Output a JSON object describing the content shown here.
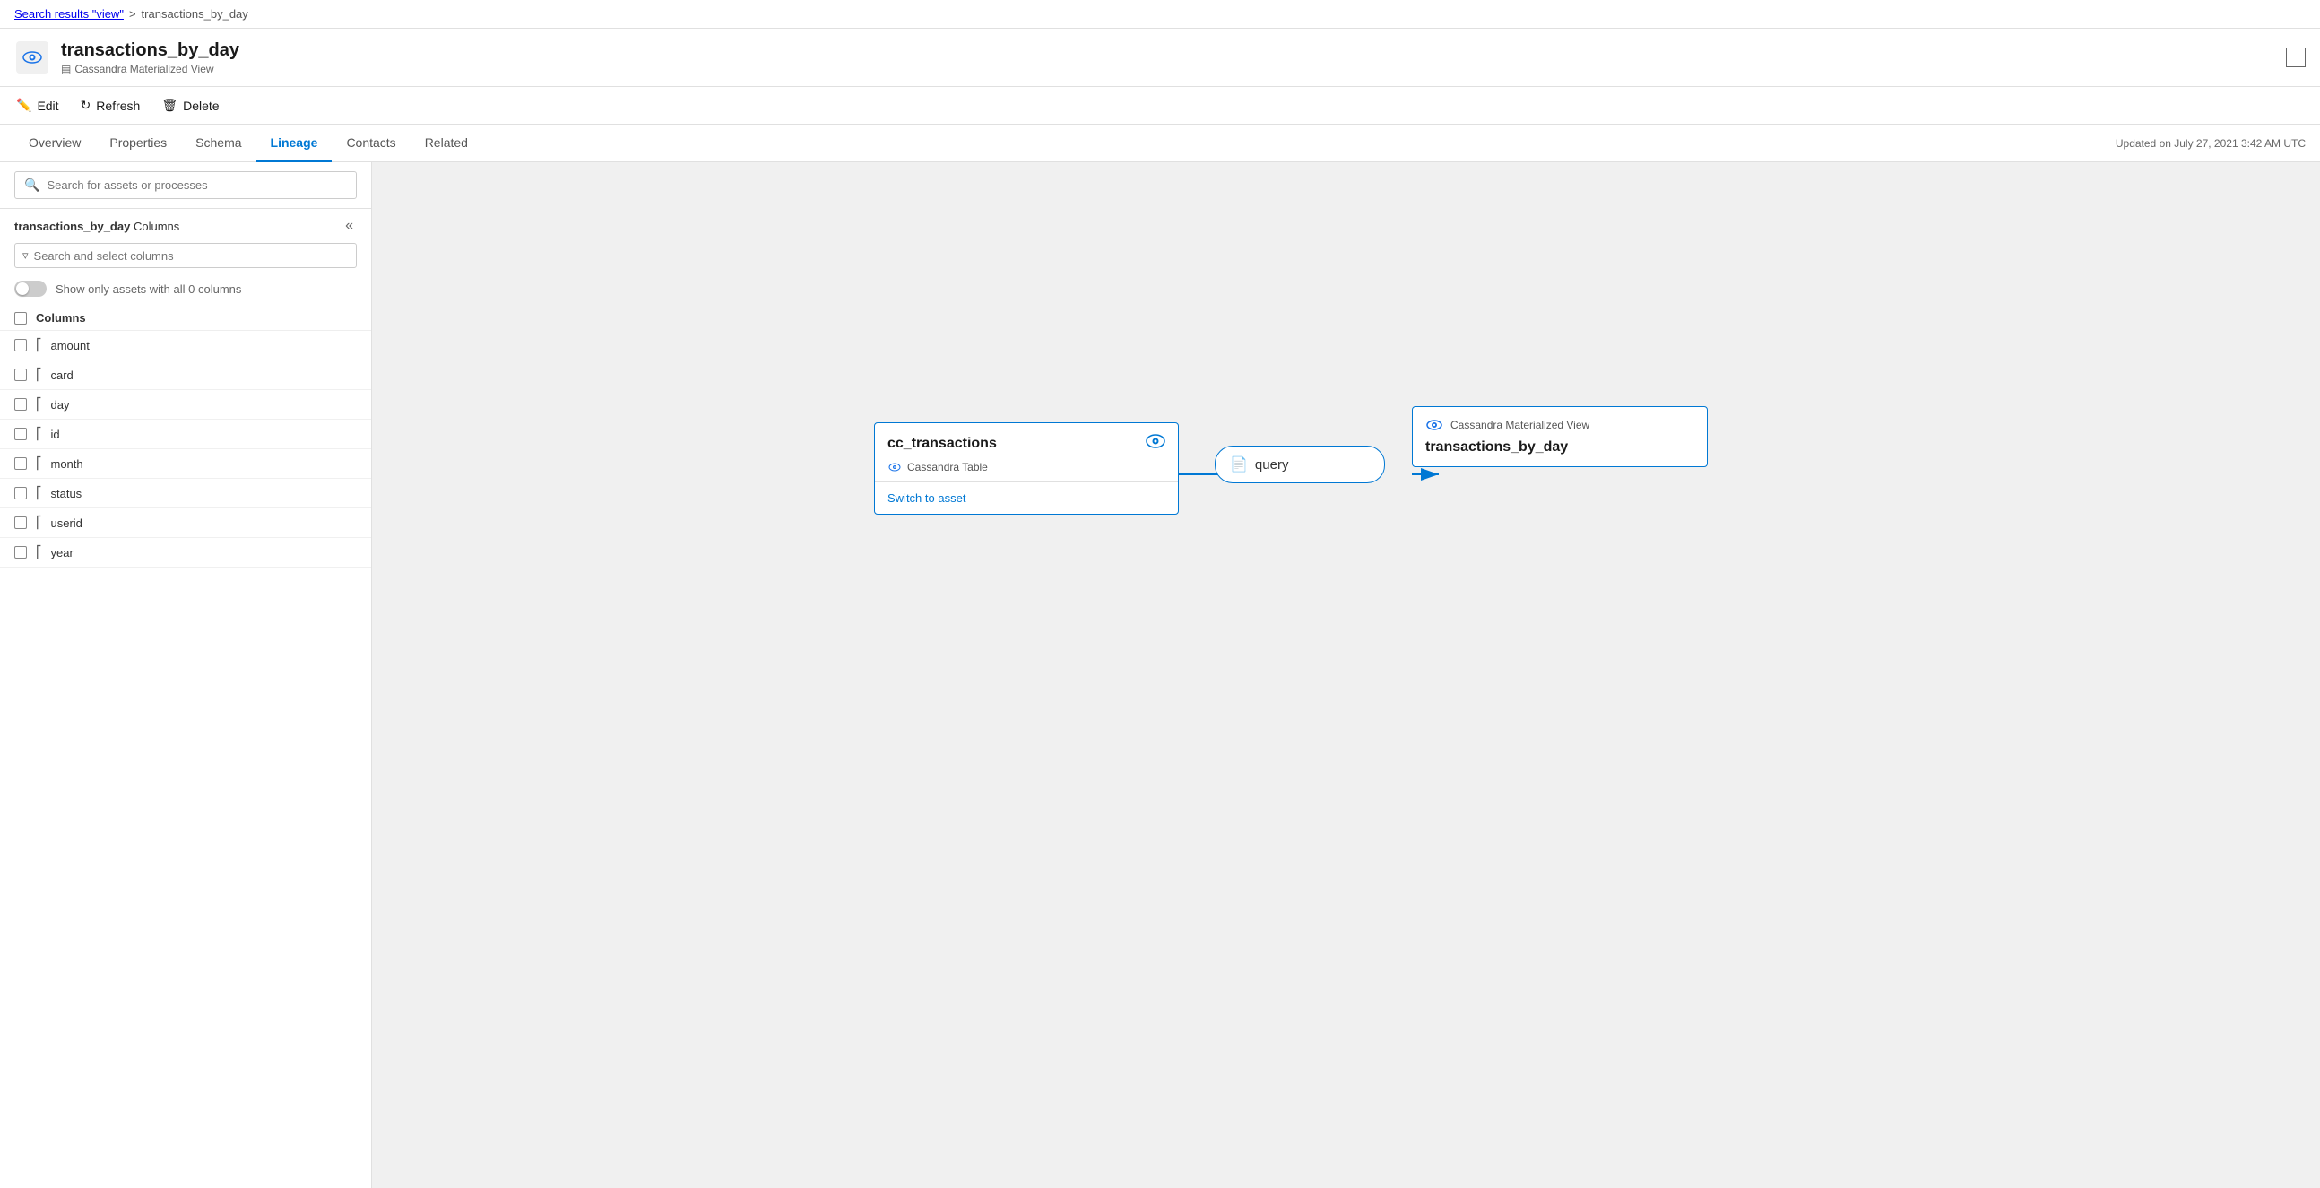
{
  "breadcrumb": {
    "link_text": "Search results \"view\"",
    "separator": ">",
    "current": "transactions_by_day"
  },
  "header": {
    "title": "transactions_by_day",
    "subtitle": "Cassandra Materialized View",
    "subtitle_icon": "table-icon"
  },
  "toolbar": {
    "edit_label": "Edit",
    "refresh_label": "Refresh",
    "delete_label": "Delete"
  },
  "tabs": [
    {
      "label": "Overview",
      "active": false
    },
    {
      "label": "Properties",
      "active": false
    },
    {
      "label": "Schema",
      "active": false
    },
    {
      "label": "Lineage",
      "active": true
    },
    {
      "label": "Contacts",
      "active": false
    },
    {
      "label": "Related",
      "active": false
    }
  ],
  "updated_text": "Updated on July 27, 2021 3:42 AM UTC",
  "lineage": {
    "search_placeholder": "Search for assets or processes",
    "columns_panel": {
      "asset_name": "transactions_by_day",
      "columns_label": "Columns",
      "column_search_placeholder": "Search and select columns",
      "toggle_label": "Show only assets with all 0 columns",
      "columns_header": "Columns",
      "items": [
        {
          "name": "amount"
        },
        {
          "name": "card"
        },
        {
          "name": "day"
        },
        {
          "name": "id"
        },
        {
          "name": "month"
        },
        {
          "name": "status"
        },
        {
          "name": "userid"
        },
        {
          "name": "year"
        }
      ]
    },
    "nodes": {
      "source": {
        "title": "cc_transactions",
        "subtitle": "Cassandra Table",
        "link": "Switch to asset"
      },
      "process": {
        "label": "query",
        "icon": "document-icon"
      },
      "destination": {
        "subtitle": "Cassandra Materialized View",
        "title": "transactions_by_day"
      }
    }
  }
}
